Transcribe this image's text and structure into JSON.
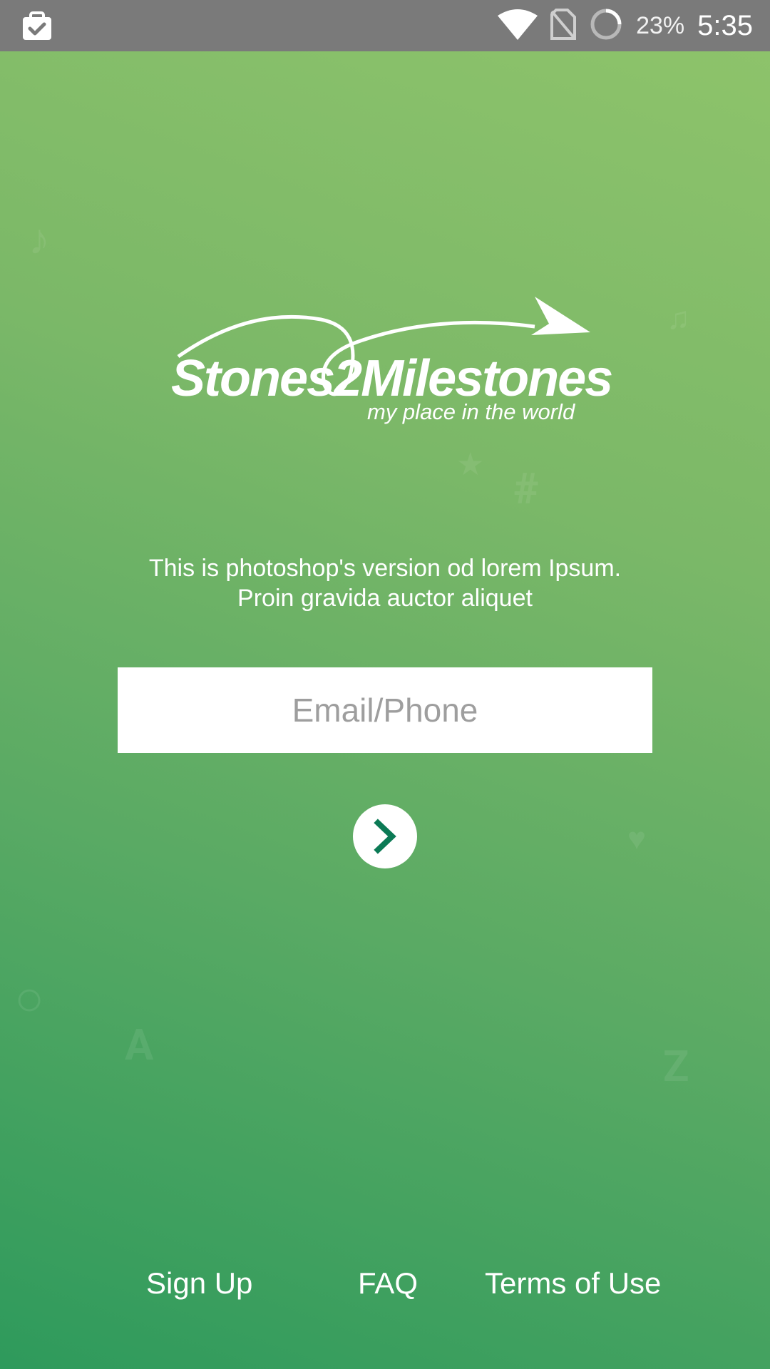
{
  "status_bar": {
    "battery_percent": "23%",
    "time": "5:35",
    "icons": [
      "clipboard-check-icon",
      "wifi-icon",
      "no-sim-icon",
      "loading-ring-icon"
    ]
  },
  "logo": {
    "name": "Stones2Milestones",
    "tagline": "my place in the world"
  },
  "intro": {
    "line1": "This is photoshop's version od lorem Ipsum.",
    "line2": "Proin gravida auctor aliquet"
  },
  "login": {
    "placeholder": "Email/Phone",
    "value": "",
    "submit_icon": "chevron-right-icon"
  },
  "footer": {
    "signup": "Sign Up",
    "faq": "FAQ",
    "terms": "Terms of Use"
  },
  "colors": {
    "status_bar": "#7a7a7a",
    "bg_top": "#8fc46b",
    "bg_bottom": "#2e9a5c",
    "accent": "#0b7a55"
  }
}
